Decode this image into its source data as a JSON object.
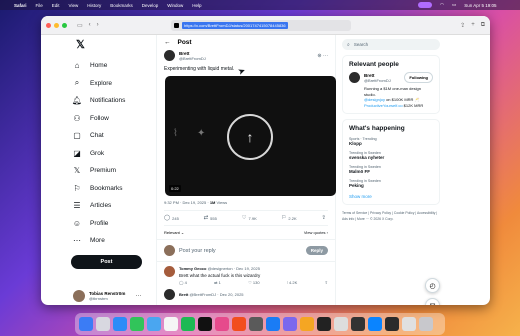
{
  "menubar": {
    "items": [
      "Safari",
      "File",
      "Edit",
      "View",
      "History",
      "Bookmarks",
      "Develop",
      "Window",
      "Help"
    ],
    "clock": "Sun Apr 5  19:05"
  },
  "browser": {
    "url": "https://x.com/BrettFromDJ/status/2001747415078445836"
  },
  "nav": {
    "items": [
      {
        "label": "Home",
        "icon": "home-icon"
      },
      {
        "label": "Explore",
        "icon": "search-icon"
      },
      {
        "label": "Notifications",
        "icon": "bell-icon"
      },
      {
        "label": "Follow",
        "icon": "follow-icon"
      },
      {
        "label": "Chat",
        "icon": "chat-icon"
      },
      {
        "label": "Grok",
        "icon": "grok-icon"
      },
      {
        "label": "Premium",
        "icon": "x-premium-icon"
      },
      {
        "label": "Bookmarks",
        "icon": "bookmark-icon"
      },
      {
        "label": "Articles",
        "icon": "articles-icon"
      },
      {
        "label": "Profile",
        "icon": "person-icon"
      },
      {
        "label": "More",
        "icon": "more-icon"
      }
    ],
    "post_label": "Post",
    "profile": {
      "name": "Tobias Renström",
      "handle": "@tbrnstrm"
    }
  },
  "main": {
    "header": "Post",
    "tweet": {
      "author": "Brett",
      "handle": "@BrettFromDJ",
      "text": "Experimenting with liquid metal.",
      "video_duration": "0:22",
      "time": "9:32 PM · Dec 19, 2025 · ",
      "views": "1M",
      "views_label": " Views",
      "stats": {
        "replies": "245",
        "reposts": "555",
        "likes": "7.9K",
        "bookmarks": "2.2K"
      }
    },
    "sort_label": "Relevant ⌄",
    "view_quotes": "View quotes ›",
    "reply_placeholder": "Post your reply",
    "reply_button": "Reply",
    "replies": [
      {
        "author": "Tommy Geoco",
        "meta": " @designerton · Dec 19, 2025",
        "text": "Brett what the actual fuck is this wizardry",
        "stats": {
          "replies": "4",
          "reposts": "1",
          "likes": "130",
          "views": "4.2K"
        }
      },
      {
        "author": "Brett",
        "meta": " @BrettFromDJ · Dec 20, 2025"
      }
    ]
  },
  "right": {
    "search_placeholder": "Search",
    "relevant_title": "Relevant people",
    "person": {
      "name": "Brett",
      "handle": "@BrettFromDJ",
      "follow_label": "Following",
      "bio_line1": "Running a $1M one-man design studio.",
      "bio_line2a": "@designjoy",
      "bio_line2b": " on $100K MRR 🥂",
      "bio_line3a": "ProductiveYourself.co",
      "bio_line3b": " $12K MRR"
    },
    "happening_title": "What's happening",
    "trends": [
      {
        "label": "Sports · Trending",
        "name": "Klopp"
      },
      {
        "label": "Trending in Sweden",
        "name": "svenska nyheter"
      },
      {
        "label": "Trending in Sweden",
        "name": "Malmö FF"
      },
      {
        "label": "Trending in Sweden",
        "name": "Peking"
      }
    ],
    "show_more": "Show more",
    "footer": "Terms of Service | Privacy Policy | Cookie Policy | Accessibility | Ads info | More ··· © 2026 X Corp."
  },
  "colors": {
    "accent": "#1d9bf0",
    "ink": "#0f1419",
    "muted": "#536471"
  }
}
